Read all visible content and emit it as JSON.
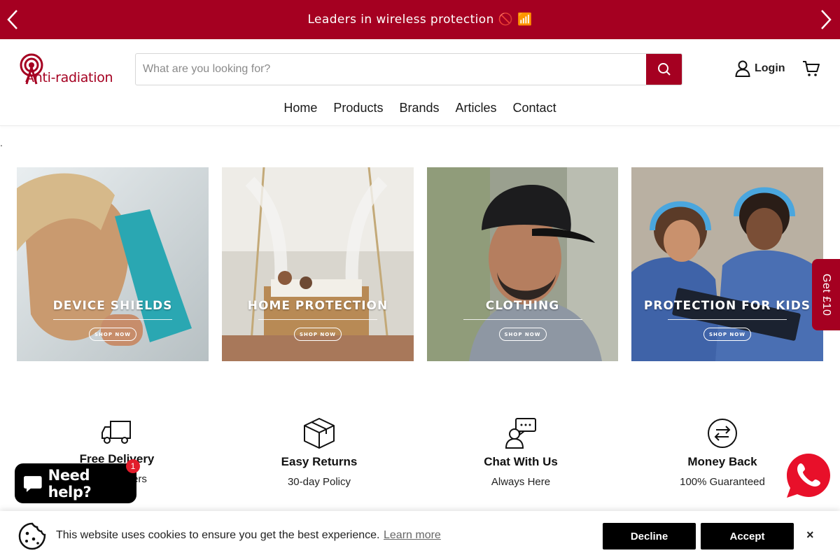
{
  "announcement": {
    "text": "Leaders in wireless protection 🚫 📶"
  },
  "header": {
    "logo_text": "Anti-radiation",
    "search_placeholder": "What are you looking for?",
    "login_label": "Login"
  },
  "nav": {
    "items": [
      "Home",
      "Products",
      "Brands",
      "Articles",
      "Contact"
    ]
  },
  "stray_text": ".",
  "categories": [
    {
      "title": "DEVICE SHIELDS",
      "cta": "SHOP NOW"
    },
    {
      "title": "HOME PROTECTION",
      "cta": "SHOP NOW"
    },
    {
      "title": "CLOTHING",
      "cta": "SHOP NOW"
    },
    {
      "title": "PROTECTION FOR KIDS",
      "cta": "SHOP NOW"
    }
  ],
  "side_tab": {
    "label": "Get £10"
  },
  "features": [
    {
      "icon": "delivery-truck-icon",
      "title": "Free Delivery",
      "sub": "On all orders"
    },
    {
      "icon": "box-icon",
      "title": "Easy Returns",
      "sub": "30-day Policy"
    },
    {
      "icon": "chat-support-icon",
      "title": "Chat With Us",
      "sub": "Always Here"
    },
    {
      "icon": "money-back-icon",
      "title": "Money Back",
      "sub": "100% Guaranteed"
    }
  ],
  "help_widget": {
    "label": "Need help?",
    "badge": "1"
  },
  "cookie": {
    "text": "This website uses cookies to ensure you get the best experience.",
    "link": "Learn more",
    "decline": "Decline",
    "accept": "Accept",
    "close": "×"
  },
  "colors": {
    "brand": "#a50021",
    "dark": "#000000",
    "whatsapp": "#e8102a"
  }
}
